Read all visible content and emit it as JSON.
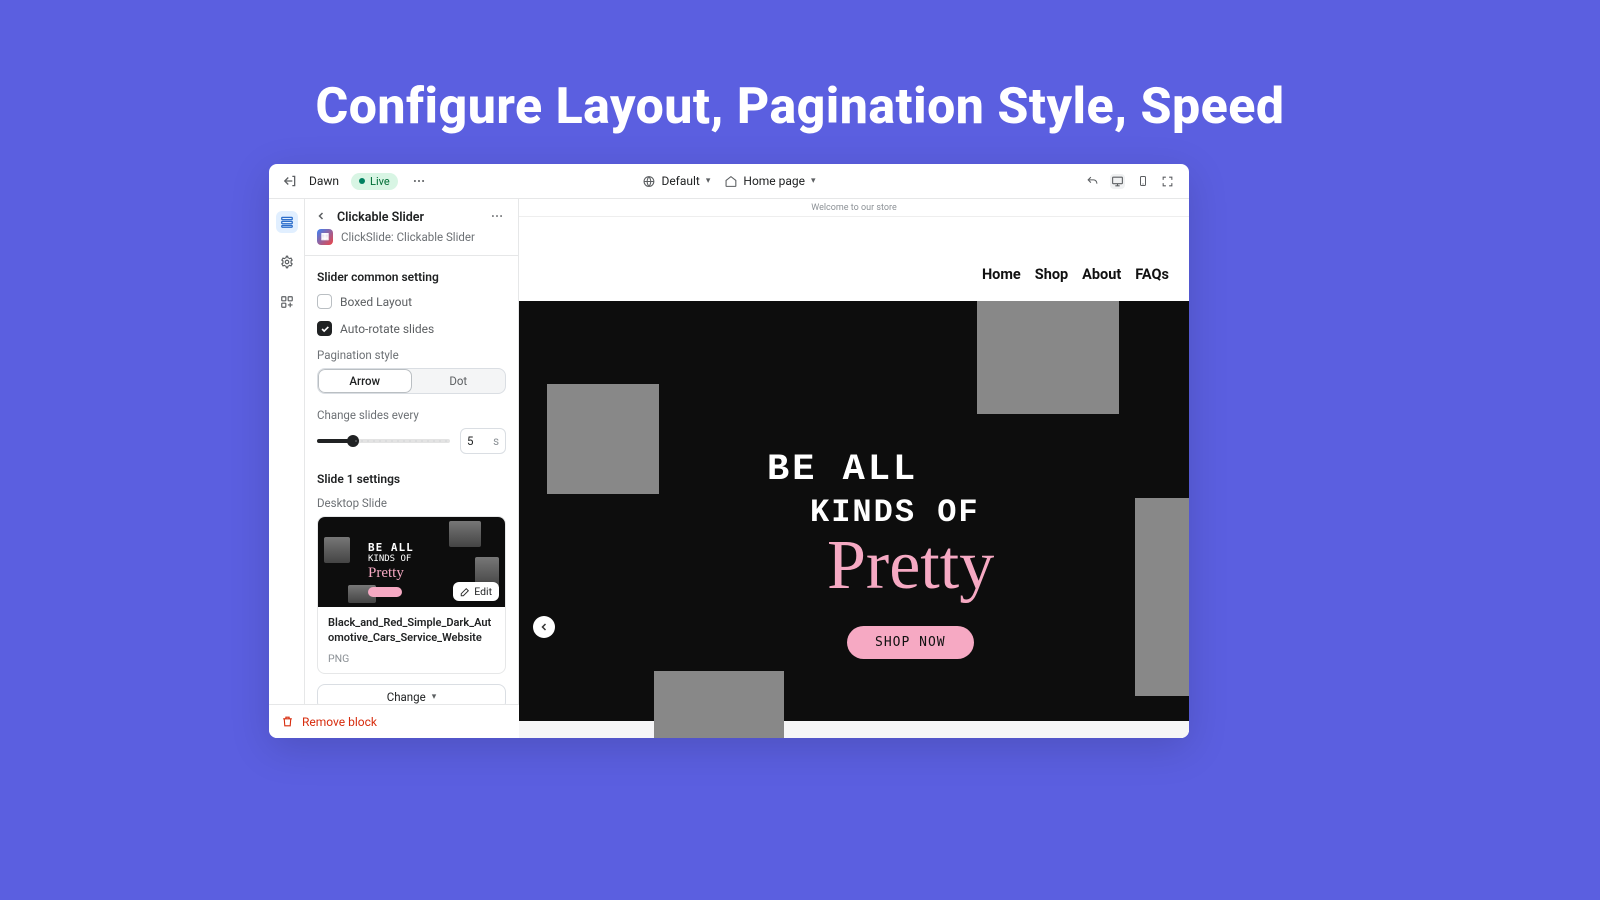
{
  "page_heading": "Configure Layout, Pagination Style, Speed",
  "topbar": {
    "theme_name": "Dawn",
    "status": "Live",
    "viewport_label": "Default",
    "page_label": "Home page"
  },
  "panel": {
    "title": "Clickable Slider",
    "app_name": "ClickSlide: Clickable Slider",
    "section_common": "Slider common setting",
    "boxed_layout": {
      "label": "Boxed Layout",
      "checked": false
    },
    "auto_rotate": {
      "label": "Auto-rotate slides",
      "checked": true
    },
    "pagination_label": "Pagination style",
    "pagination_options": {
      "arrow": "Arrow",
      "dot": "Dot"
    },
    "pagination_active": "arrow",
    "change_every_label": "Change slides every",
    "change_every_value": "5",
    "change_every_unit": "s",
    "section_slide": "Slide 1 settings",
    "desktop_slide_label": "Desktop Slide",
    "slide_filename": "Black_and_Red_Simple_Dark_Automotive_Cars_Service_Website",
    "slide_filetype": "PNG",
    "edit_label": "Edit",
    "change_label": "Change",
    "remove_label": "Remove block"
  },
  "preview": {
    "announce": "Welcome to our store",
    "nav": {
      "home": "Home",
      "shop": "Shop",
      "about": "About",
      "faqs": "FAQs"
    },
    "hero_line1": "BE ALL",
    "hero_line2": "KINDS OF",
    "hero_line3": "Pretty",
    "cta": "SHOP NOW"
  }
}
